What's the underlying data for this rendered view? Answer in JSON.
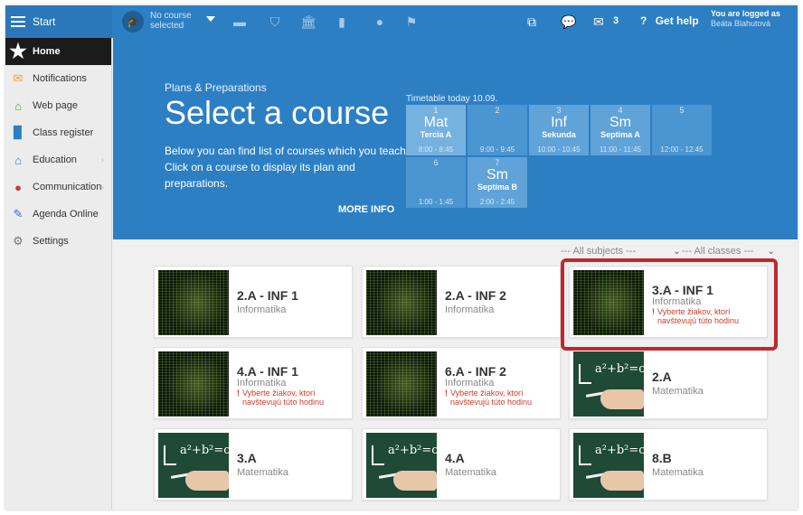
{
  "topbar": {
    "start_label": "Start",
    "course_selector": {
      "line1": "No course",
      "line2": "selected"
    },
    "mail_count": "3",
    "help_label": "Get help",
    "logged_as_label": "You are logged as",
    "user_name": "Beáta Blahutová"
  },
  "sidebar": {
    "items": [
      {
        "label": "Home",
        "icon": "star-icon",
        "active": true
      },
      {
        "label": "Notifications",
        "icon": "envelope-icon"
      },
      {
        "label": "Web page",
        "icon": "house-icon"
      },
      {
        "label": "Class register",
        "icon": "book-icon"
      },
      {
        "label": "Education",
        "icon": "school-icon",
        "chevron": true
      },
      {
        "label": "Communication",
        "icon": "chat-icon",
        "chevron": true
      },
      {
        "label": "Agenda Online",
        "icon": "pen-icon"
      },
      {
        "label": "Settings",
        "icon": "gear-icon"
      }
    ]
  },
  "hero": {
    "subtitle": "Plans & Preparations",
    "title": "Select a course",
    "description": "Below you can find list of courses which you teach. Click on a course to display its plan and preparations.",
    "more_info": "MORE INFO"
  },
  "timetable": {
    "label": "Timetable today 10.09.",
    "slots": [
      {
        "num": "1",
        "subject": "Mat",
        "class": "Tercia A",
        "time": "8:00 - 8:45"
      },
      {
        "num": "2",
        "subject": "",
        "class": "",
        "time": "9:00 - 9:45"
      },
      {
        "num": "3",
        "subject": "Inf",
        "class": "Sekunda",
        "time": "10:00 - 10:45"
      },
      {
        "num": "4",
        "subject": "Sm",
        "class": "Septima A",
        "time": "11:00 - 11:45"
      },
      {
        "num": "5",
        "subject": "",
        "class": "",
        "time": "12:00 - 12:45"
      },
      {
        "num": "6",
        "subject": "",
        "class": "",
        "time": "1:00 - 1:45"
      },
      {
        "num": "7",
        "subject": "Sm",
        "class": "Septima B",
        "time": "2:00 - 2:45"
      }
    ]
  },
  "filters": {
    "subjects": "--- All subjects ---",
    "classes": "--- All classes ---"
  },
  "courses": [
    {
      "title": "2.A - INF 1",
      "subject": "Informatika",
      "warning": "",
      "thumb": "code"
    },
    {
      "title": "2.A - INF 2",
      "subject": "Informatika",
      "warning": "",
      "thumb": "code"
    },
    {
      "title": "3.A - INF 1",
      "subject": "Informatika",
      "warning": "Vyberte žiakov, ktorí navštevujú túto hodinu",
      "thumb": "code"
    },
    {
      "title": "4.A - INF 1",
      "subject": "Informatika",
      "warning": "Vyberte žiakov, ktorí navštevujú túto hodinu",
      "thumb": "code"
    },
    {
      "title": "6.A - INF 2",
      "subject": "Informatika",
      "warning": "Vyberte žiakov, ktorí navštevujú túto hodinu",
      "thumb": "code"
    },
    {
      "title": "2.A",
      "subject": "Matematika",
      "warning": "",
      "thumb": "board"
    },
    {
      "title": "3.A",
      "subject": "Matematika",
      "warning": "",
      "thumb": "board"
    },
    {
      "title": "4.A",
      "subject": "Matematika",
      "warning": "",
      "thumb": "board"
    },
    {
      "title": "8.B",
      "subject": "Matematika",
      "warning": "",
      "thumb": "board"
    }
  ],
  "board_equation": "a²+b²=c",
  "colors": {
    "brand": "#2d7fc4",
    "warning": "#d03c2a",
    "highlight": "#c0282c"
  }
}
